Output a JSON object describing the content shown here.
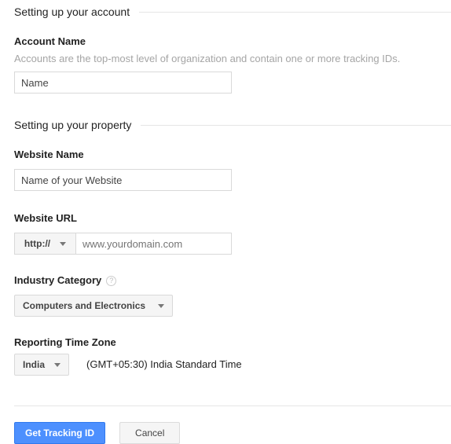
{
  "account_section": {
    "heading": "Setting up your account",
    "account_name": {
      "label": "Account Name",
      "help_text": "Accounts are the top-most level of organization and contain one or more tracking IDs.",
      "placeholder": "Name",
      "value": ""
    }
  },
  "property_section": {
    "heading": "Setting up your property",
    "website_name": {
      "label": "Website Name",
      "placeholder": "Name of your Website",
      "value": ""
    },
    "website_url": {
      "label": "Website URL",
      "scheme_selected": "http://",
      "placeholder": "www.yourdomain.com",
      "value": ""
    },
    "industry_category": {
      "label": "Industry Category",
      "help_icon": "question-mark-icon",
      "selected": "Computers and Electronics"
    },
    "reporting_time_zone": {
      "label": "Reporting Time Zone",
      "selected_country": "India",
      "description": "(GMT+05:30) India Standard Time"
    }
  },
  "footer": {
    "submit_label": "Get Tracking ID",
    "cancel_label": "Cancel"
  },
  "icons": {
    "caret": "chevron-down-icon",
    "help": "?"
  },
  "colors": {
    "primary_button": "#4d90fe",
    "primary_button_border": "#3079ed",
    "input_border": "#d9d9d9",
    "rule": "#e5e5e5",
    "help_text": "#a5a5a5",
    "body_text": "#222222"
  }
}
